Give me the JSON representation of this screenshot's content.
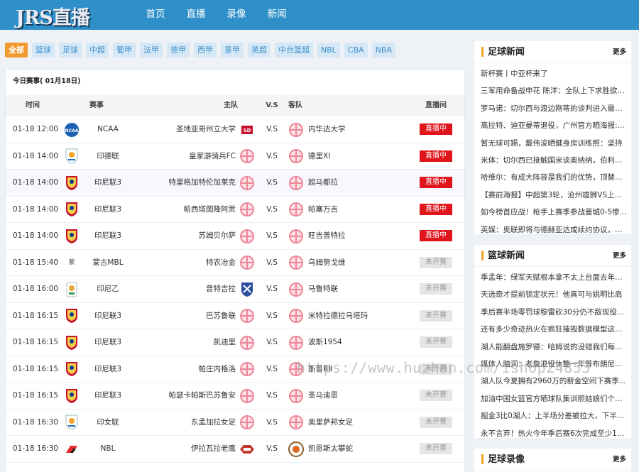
{
  "header": {
    "logo": "JRS直播",
    "nav": [
      "首页",
      "直播",
      "录像",
      "新闻"
    ]
  },
  "categories": [
    "全部",
    "篮球",
    "足球",
    "中超",
    "葡甲",
    "法甲",
    "德甲",
    "西甲",
    "意甲",
    "英超",
    "中台篮超",
    "NBL",
    "CBA",
    "NBA"
  ],
  "schedule": {
    "title": "今日赛事( 01月18日)",
    "headers": {
      "time": "时间",
      "comp": "赛事",
      "home": "主队",
      "vs": "V.S",
      "away": "客队",
      "status": "直播间"
    },
    "vs_text": "V.S",
    "rows": [
      {
        "time": "01-18 12:00",
        "comp": "NCAA",
        "home": "圣地亚哥州立大学",
        "away": "内华达大学",
        "status": "直播中",
        "live": true
      },
      {
        "time": "01-18 14:00",
        "comp": "印德联",
        "home": "皇家游骑兵FC",
        "away": "德里XI",
        "status": "直播中",
        "live": true
      },
      {
        "time": "01-18 14:00",
        "comp": "印尼联3",
        "home": "特里格加特伦加莱克",
        "away": "超马都拉",
        "status": "直播中",
        "live": true
      },
      {
        "time": "01-18 14:00",
        "comp": "印尼联3",
        "home": "帕西塔图隆阿贡",
        "away": "帕塞万吉",
        "status": "直播中",
        "live": true
      },
      {
        "time": "01-18 14:00",
        "comp": "印尼联3",
        "home": "苏姆贝尔萨",
        "away": "旺吉普特拉",
        "status": "直播中",
        "live": true
      },
      {
        "time": "01-18 15:40",
        "comp": "蒙古MBL",
        "home": "特农冶金",
        "away": "乌姆努戈维",
        "status": "未开赛",
        "live": false
      },
      {
        "time": "01-18 16:00",
        "comp": "印尼乙",
        "home": "普特吉拉",
        "away": "马鲁特联",
        "status": "未开赛",
        "live": false
      },
      {
        "time": "01-18 16:15",
        "comp": "印尼联3",
        "home": "巴苏鲁联",
        "away": "米特拉德拉乌塔玛",
        "status": "未开赛",
        "live": false
      },
      {
        "time": "01-18 16:15",
        "comp": "印尼联3",
        "home": "凯迪里",
        "away": "波斯1954",
        "status": "未开赛",
        "live": false
      },
      {
        "time": "01-18 16:15",
        "comp": "印尼联3",
        "home": "帕庄内格洛",
        "away": "斯普BII",
        "status": "未开赛",
        "live": false
      },
      {
        "time": "01-18 16:15",
        "comp": "印尼联3",
        "home": "帕瑟卡帕斯巴苏鲁安",
        "away": "圣马迪恩",
        "status": "未开赛",
        "live": false
      },
      {
        "time": "01-18 16:30",
        "comp": "印女联",
        "home": "东孟加拉女足",
        "away": "奥里萨邦女足",
        "status": "未开赛",
        "live": false
      },
      {
        "time": "01-18 16:30",
        "comp": "NBL",
        "home": "伊拉瓦拉老鹰",
        "away": "凯恩斯太攀蛇",
        "status": "未开赛",
        "live": false
      }
    ]
  },
  "sidebar": {
    "football_news": {
      "title": "足球新闻",
      "more": "更多",
      "items": [
        "新杯赛丨中亚杯来了",
        "三军用命备战申花 陈洋：全队上下求胜欲...",
        "罗马诺：切尔西与渡边刚蒂的谈判进入最后...",
        "高拉特、迪亚曼蒂退役，广州官方晒海报:...",
        "暂无球可踢，戴伟浚晒健身房训练照：坚持",
        "米体：切尔西已接触国米谈奥纳纳，伯利准...",
        "哈维尔：有成大阵容是我们的优势，顶替蒂...",
        "【赛前海报】中超第3轮，沧州雄狮VS上海...",
        "如今榜首应战！枪手上赛季参战曼城0-5惨...",
        "英媒：奥联即将与德赫亚达成续约协议，球..."
      ]
    },
    "basketball_news": {
      "title": "篮球新闻",
      "more": "更多",
      "items": [
        "季孟年：绿军天赋根本拿不太上台面去年的...",
        "天选奇才提前锁定状元！他真可与姚明比肩",
        "季后赛半场零罚球穆雷砍30分仍不敌现役...",
        "还有多少奇迹热火在疯狂摧毁数据模型这正...",
        "湖人能翻盘施罗德：哈姆说的没错我们每个...",
        "媒体人脑洞：老詹退役休整一年等布朗尼进...",
        "湖人队今夏拥有2960万的薪金空间下赛季...",
        "加油中国女篮官方晒球队集训照姑娘们个个...",
        "掘金3比0湖人：上半场分差被拉大，下半场众...",
        "永不言弃！热火今年季后赛6次完成至少12..."
      ]
    },
    "football_video": {
      "title": "足球录像",
      "more": "更多"
    }
  },
  "watermark": "https://www.huzhan.com/ishop24853",
  "colors": {
    "header": "#2f90c9",
    "accent": "#f19a2f",
    "live": "#e0141b",
    "tag_bg": "#d6e8f6",
    "tag_text": "#3d8fcc"
  }
}
